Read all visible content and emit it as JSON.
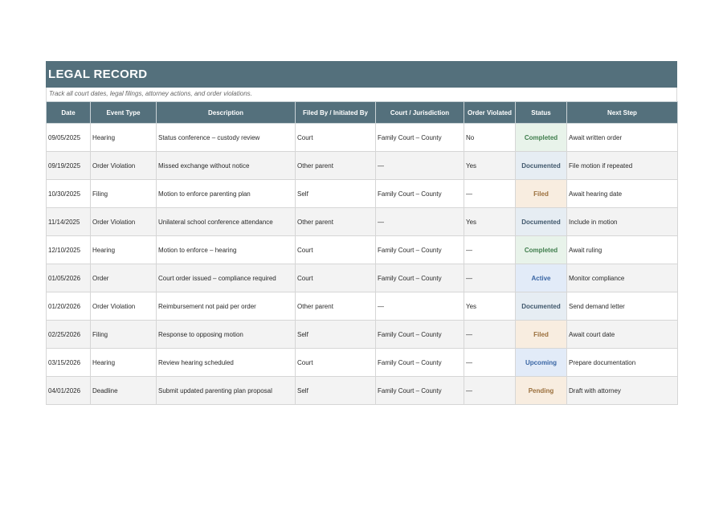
{
  "header": {
    "title": "LEGAL RECORD",
    "subtitle": "Track all court dates, legal filings, attorney actions, and order violations."
  },
  "table": {
    "columns": [
      "Date",
      "Event Type",
      "Description",
      "Filed By / Initiated By",
      "Court / Jurisdiction",
      "Order Violated",
      "Status",
      "Next Step"
    ],
    "rows": [
      {
        "date": "09/05/2025",
        "event_type": "Hearing",
        "description": "Status conference – custody review",
        "filed_by": "Court",
        "court": "Family Court – County",
        "order_violated": "No",
        "status": "Completed",
        "next_step": "Await written order"
      },
      {
        "date": "09/19/2025",
        "event_type": "Order Violation",
        "description": "Missed exchange without notice",
        "filed_by": "Other parent",
        "court": "—",
        "order_violated": "Yes",
        "status": "Documented",
        "next_step": "File motion if repeated"
      },
      {
        "date": "10/30/2025",
        "event_type": "Filing",
        "description": "Motion to enforce parenting plan",
        "filed_by": "Self",
        "court": "Family Court – County",
        "order_violated": "—",
        "status": "Filed",
        "next_step": "Await hearing date"
      },
      {
        "date": "11/14/2025",
        "event_type": "Order Violation",
        "description": "Unilateral school conference attendance",
        "filed_by": "Other parent",
        "court": "—",
        "order_violated": "Yes",
        "status": "Documented",
        "next_step": "Include in motion"
      },
      {
        "date": "12/10/2025",
        "event_type": "Hearing",
        "description": "Motion to enforce – hearing",
        "filed_by": "Court",
        "court": "Family Court – County",
        "order_violated": "—",
        "status": "Completed",
        "next_step": "Await ruling"
      },
      {
        "date": "01/05/2026",
        "event_type": "Order",
        "description": "Court order issued – compliance required",
        "filed_by": "Court",
        "court": "Family Court – County",
        "order_violated": "—",
        "status": "Active",
        "next_step": "Monitor compliance"
      },
      {
        "date": "01/20/2026",
        "event_type": "Order Violation",
        "description": "Reimbursement not paid per order",
        "filed_by": "Other parent",
        "court": "—",
        "order_violated": "Yes",
        "status": "Documented",
        "next_step": "Send demand letter"
      },
      {
        "date": "02/25/2026",
        "event_type": "Filing",
        "description": "Response to opposing motion",
        "filed_by": "Self",
        "court": "Family Court – County",
        "order_violated": "—",
        "status": "Filed",
        "next_step": "Await court date"
      },
      {
        "date": "03/15/2026",
        "event_type": "Hearing",
        "description": "Review hearing scheduled",
        "filed_by": "Court",
        "court": "Family Court – County",
        "order_violated": "—",
        "status": "Upcoming",
        "next_step": "Prepare documentation"
      },
      {
        "date": "04/01/2026",
        "event_type": "Deadline",
        "description": "Submit updated parenting plan proposal",
        "filed_by": "Self",
        "court": "Family Court – County",
        "order_violated": "—",
        "status": "Pending",
        "next_step": "Draft with attorney"
      }
    ]
  },
  "status_colors": {
    "Completed": "#3f7d4c",
    "Documented": "#40586c",
    "Filed": "#9a6f3c",
    "Active": "#3a66a4",
    "Upcoming": "#3a66a4",
    "Pending": "#9a6f3c"
  },
  "colors": {
    "header_bg": "#54707c"
  }
}
